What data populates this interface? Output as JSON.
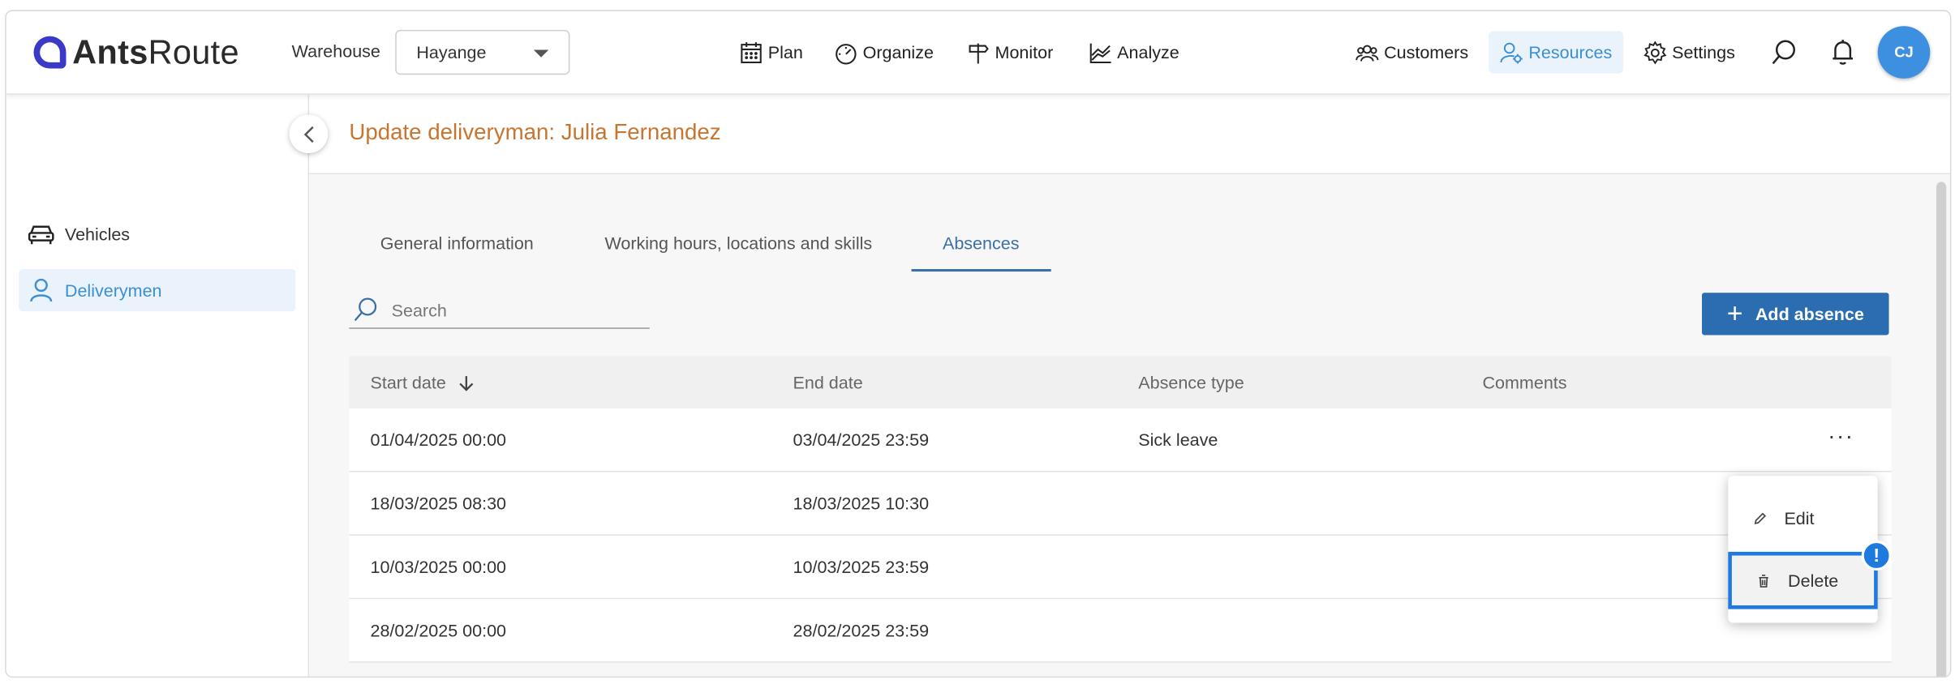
{
  "app": {
    "logo": {
      "bold": "Ants",
      "light": "Route"
    },
    "warehouse": {
      "label": "Warehouse",
      "selected": "Hayange"
    },
    "nav": {
      "plan": "Plan",
      "organize": "Organize",
      "monitor": "Monitor",
      "analyze": "Analyze"
    },
    "right_nav": {
      "customers": "Customers",
      "resources": "Resources",
      "settings": "Settings"
    },
    "avatar_initials": "CJ",
    "colors": {
      "accent": "#2c6db1",
      "active_nav": "#3b8fd4",
      "title": "#c87530",
      "focus": "#1f7ae0"
    }
  },
  "sidebar": {
    "items": [
      {
        "label": "Vehicles",
        "icon": "car-icon"
      },
      {
        "label": "Deliverymen",
        "icon": "person-icon"
      }
    ]
  },
  "page": {
    "title": "Update deliveryman: Julia Fernandez",
    "tabs": [
      "General information",
      "Working hours, locations and skills",
      "Absences"
    ],
    "active_tab": "Absences",
    "search_placeholder": "Search",
    "add_button": "Add absence"
  },
  "table": {
    "headers": [
      "Start date",
      "End date",
      "Absence type",
      "Comments"
    ],
    "sort": "Start date descending",
    "rows": [
      {
        "start": "01/04/2025 00:00",
        "end": "03/04/2025 23:59",
        "type": "Sick leave",
        "comments": ""
      },
      {
        "start": "18/03/2025 08:30",
        "end": "18/03/2025 10:30",
        "type": "",
        "comments": ""
      },
      {
        "start": "10/03/2025 00:00",
        "end": "10/03/2025 23:59",
        "type": "",
        "comments": ""
      },
      {
        "start": "28/02/2025 00:00",
        "end": "28/02/2025 23:59",
        "type": "",
        "comments": ""
      }
    ],
    "more_label": "···"
  },
  "context_menu": {
    "items": [
      "Edit",
      "Delete"
    ],
    "badge": "!"
  }
}
